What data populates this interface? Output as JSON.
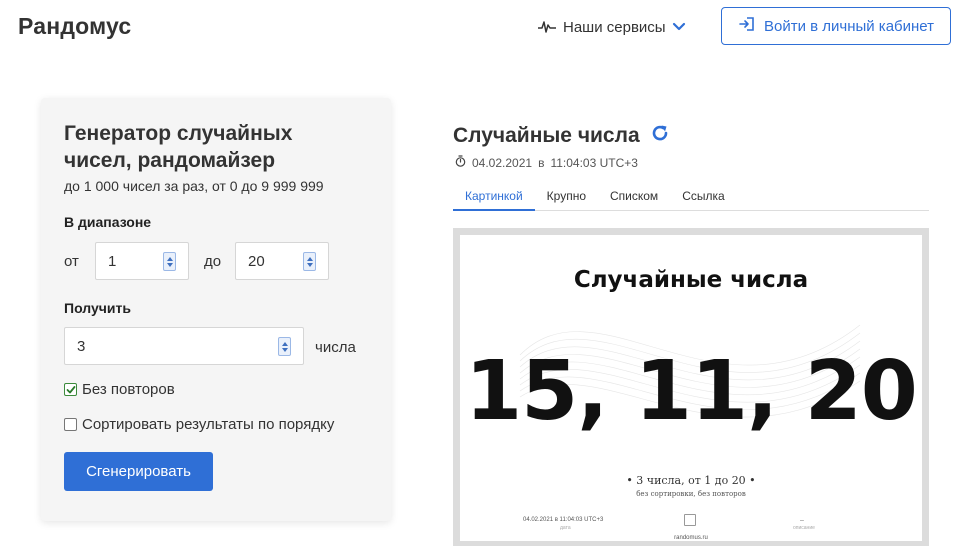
{
  "header": {
    "logo": "Рандомус",
    "services_label": "Наши сервисы",
    "login_label": "Войти в личный кабинет"
  },
  "form": {
    "title": "Генератор случайных чисел, рандомайзер",
    "subtitle": "до 1 000 чисел за раз, от 0 до 9 999 999",
    "range_label": "В диапазоне",
    "from_label": "от",
    "from_value": "1",
    "to_label": "до",
    "to_value": "20",
    "get_label": "Получить",
    "count_value": "3",
    "count_unit": "числа",
    "no_repeat_label": "Без повторов",
    "no_repeat_checked": true,
    "sort_label": "Сортировать результаты по порядку",
    "sort_checked": false,
    "generate_label": "Сгенерировать"
  },
  "result": {
    "title": "Случайные числа",
    "date": "04.02.2021",
    "date_sep": "в",
    "time": "11:04:03 UTC+3",
    "tabs": [
      {
        "label": "Картинкой",
        "active": true
      },
      {
        "label": "Крупно",
        "active": false
      },
      {
        "label": "Списком",
        "active": false
      },
      {
        "label": "Ссылка",
        "active": false
      }
    ],
    "image": {
      "title": "Случайные числа",
      "numbers": "15, 11, 20",
      "caption": "• 3 числа, от 1 до 20 •",
      "caption2": "без сортировки, без повторов",
      "footer_date": "04.02.2021 в 11:04:03 UTC+3",
      "footer_date_label": "дата",
      "footer_dash": "–",
      "footer_dash_label": "описание",
      "footer_site": "randomus.ru"
    }
  },
  "colors": {
    "accent": "#2f6fd6",
    "card_bg": "#f5f5f5",
    "frame_bg": "#dcdcdc"
  }
}
